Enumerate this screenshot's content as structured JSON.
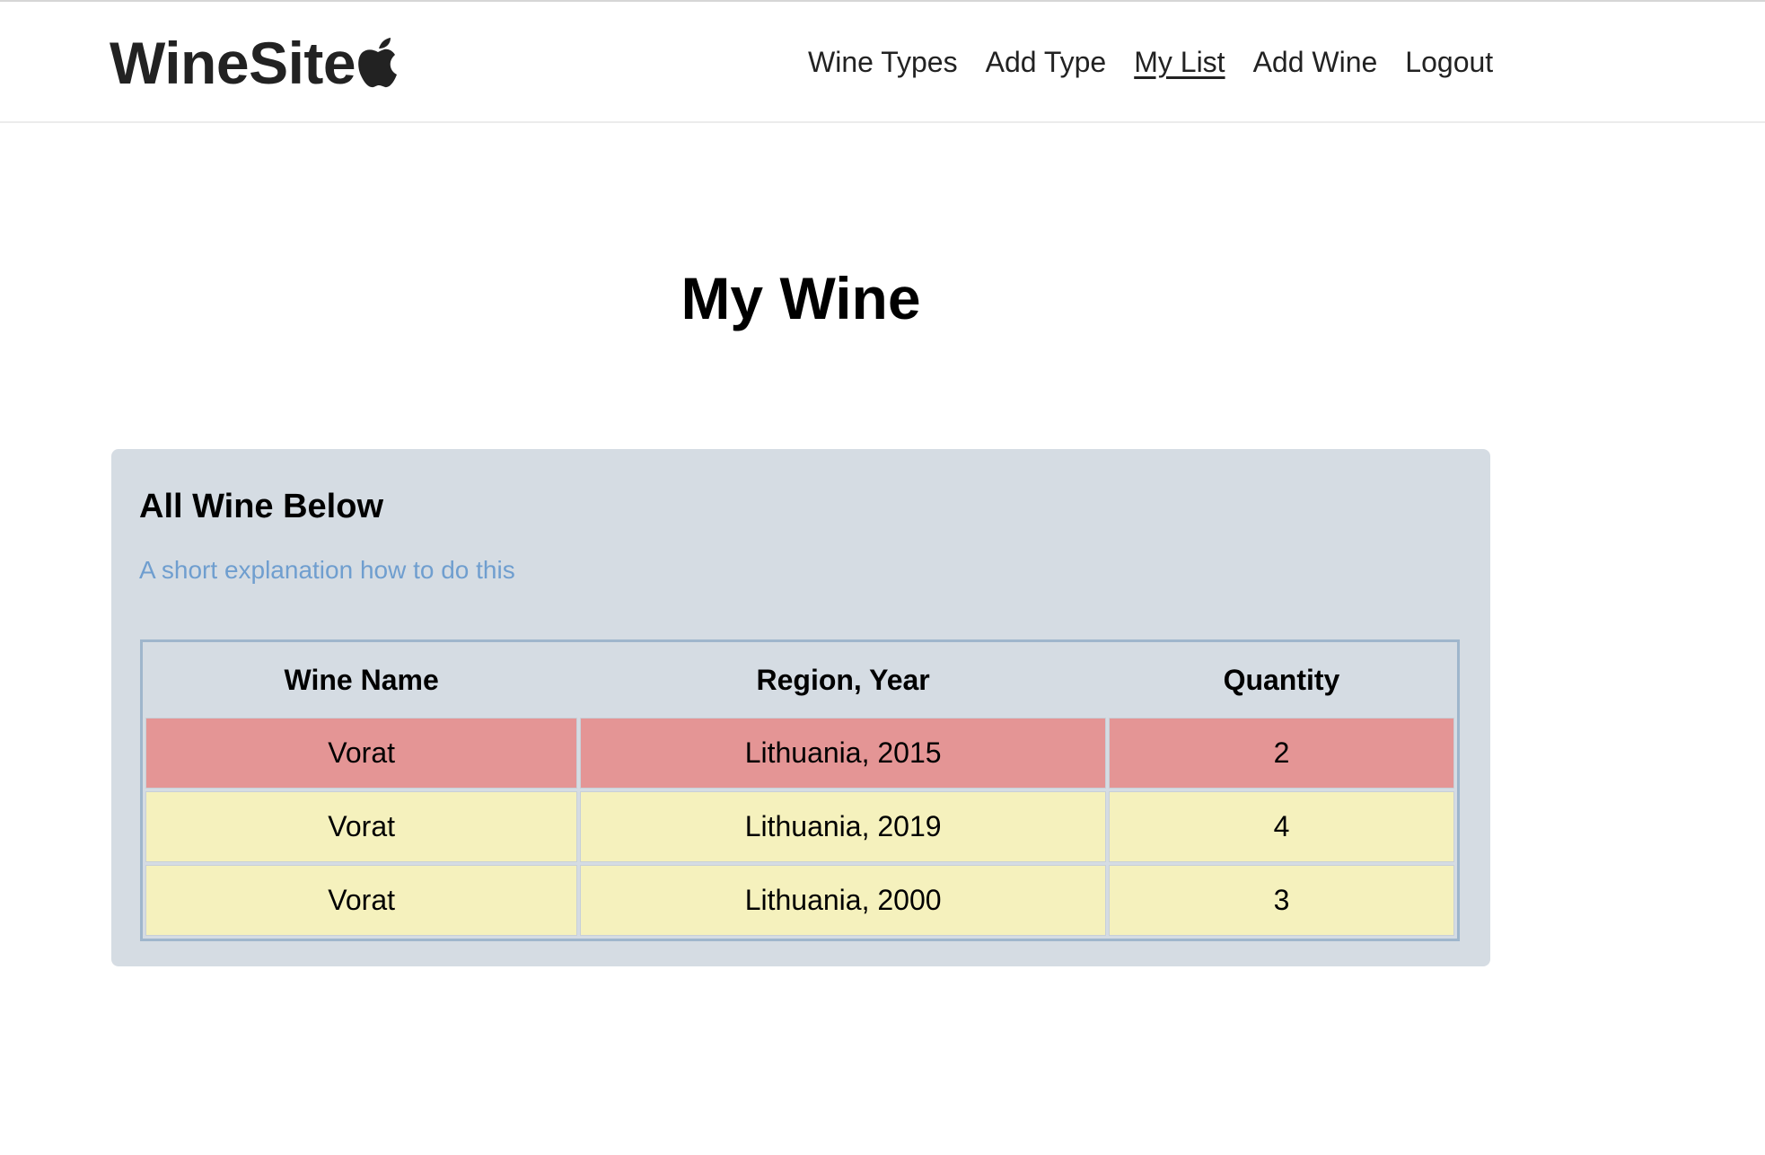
{
  "brand": {
    "name": "WineSite",
    "icon": "apple-icon"
  },
  "nav": {
    "items": [
      {
        "label": "Wine Types",
        "active": false
      },
      {
        "label": "Add Type",
        "active": false
      },
      {
        "label": "My List",
        "active": true
      },
      {
        "label": "Add Wine",
        "active": false
      },
      {
        "label": "Logout",
        "active": false
      }
    ]
  },
  "page": {
    "title": "My Wine"
  },
  "panel": {
    "title": "All Wine Below",
    "subtitle": "A short explanation how to do this"
  },
  "table": {
    "headers": [
      "Wine Name",
      "Region, Year",
      "Quantity"
    ],
    "rows": [
      {
        "name": "Vorat",
        "region_year": "Lithuania, 2015",
        "quantity": "2",
        "highlight": "alert"
      },
      {
        "name": "Vorat",
        "region_year": "Lithuania, 2019",
        "quantity": "4",
        "highlight": "normal"
      },
      {
        "name": "Vorat",
        "region_year": "Lithuania, 2000",
        "quantity": "3",
        "highlight": "normal"
      }
    ]
  },
  "colors": {
    "panel_bg": "#d5dce3",
    "row_alert": "#e49595",
    "row_normal": "#f5f1bd",
    "subtitle": "#6f9ecf"
  }
}
